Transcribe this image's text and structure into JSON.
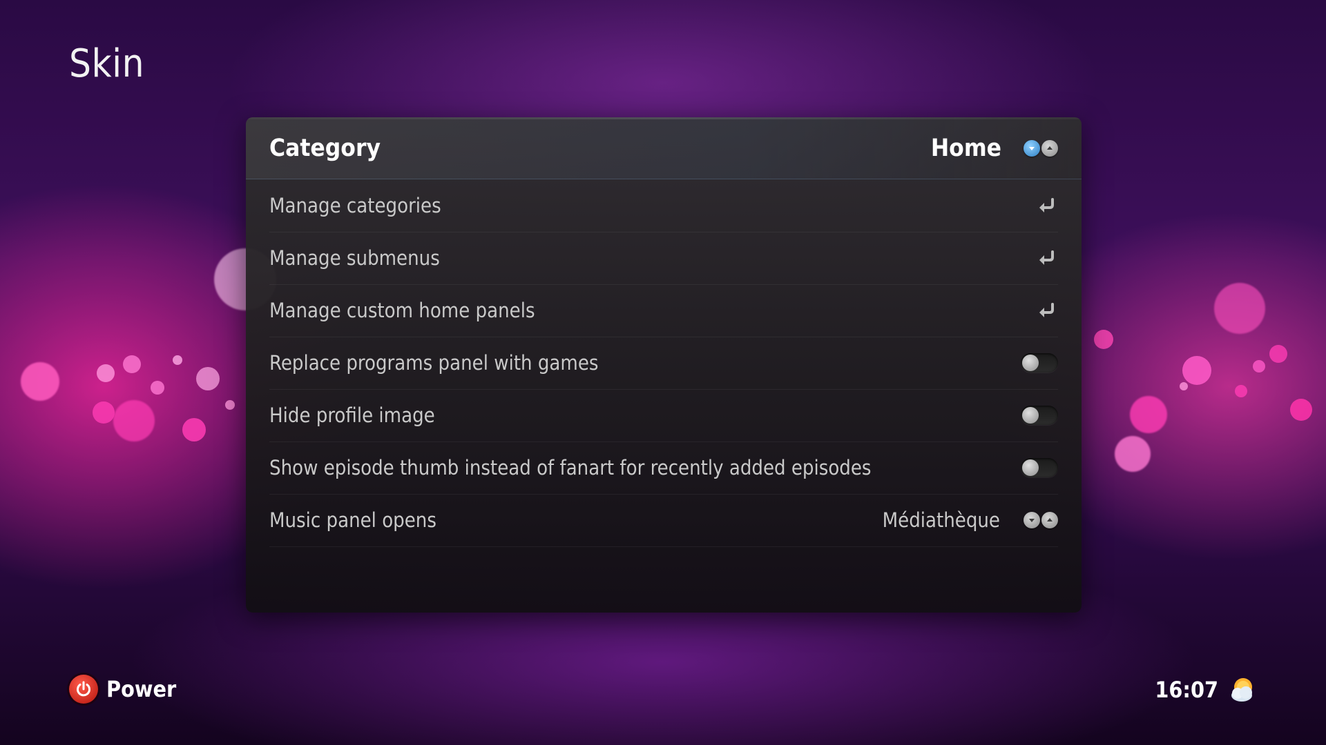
{
  "screen": {
    "title": "Skin"
  },
  "settings": {
    "category": {
      "label": "Category",
      "value": "Home"
    },
    "rows": [
      {
        "label": "Manage categories",
        "control": "action"
      },
      {
        "label": "Manage submenus",
        "control": "action"
      },
      {
        "label": "Manage custom home panels",
        "control": "action"
      },
      {
        "label": "Replace programs panel with games",
        "control": "toggle",
        "on": false
      },
      {
        "label": "Hide profile image",
        "control": "toggle",
        "on": false
      },
      {
        "label": "Show episode thumb instead of fanart for recently added episodes",
        "control": "toggle",
        "on": false
      },
      {
        "label": "Music panel opens",
        "control": "spinner",
        "value": "Médiathèque"
      }
    ]
  },
  "footer": {
    "power_label": "Power",
    "time": "16:07",
    "weather_icon": "partly-cloudy-icon"
  },
  "colors": {
    "accent": "#2e7fc2",
    "power": "#d11a10",
    "background": "#3d0f5a",
    "bokeh": "#ff3cb4"
  }
}
